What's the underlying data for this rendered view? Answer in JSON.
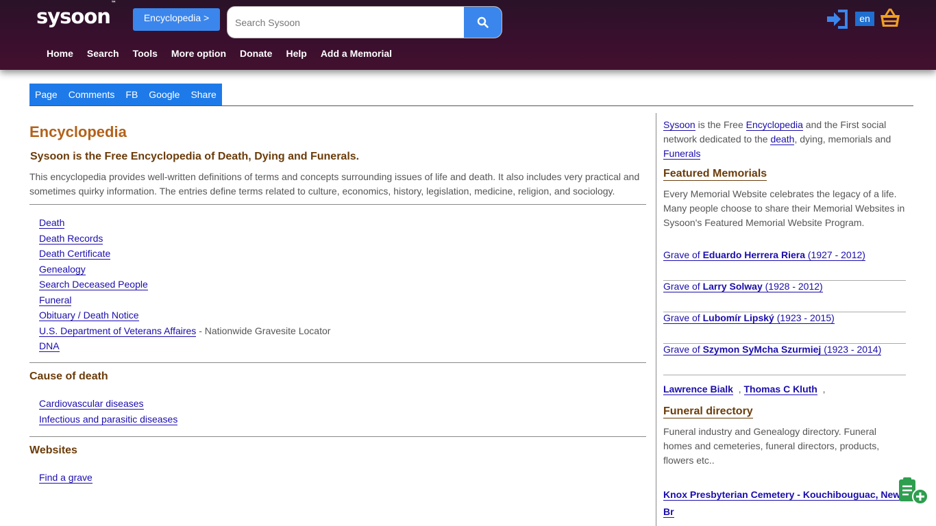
{
  "header": {
    "logo": "sysoon",
    "logo_tm": "™",
    "section_button": "Encyclopedia >",
    "search_placeholder": "Search Sysoon",
    "language": "en",
    "nav": [
      "Home",
      "Search",
      "Tools",
      "More option",
      "Donate",
      "Help",
      "Add a Memorial"
    ]
  },
  "tabs": [
    "Page",
    "Comments",
    "FB",
    "Google",
    "Share"
  ],
  "main": {
    "title": "Encyclopedia",
    "subtitle": "Sysoon is the Free Encyclopedia of Death, Dying and Funerals.",
    "intro": "This encyclopedia provides well-written definitions of terms and concepts surrounding issues of life and death. It also includes very practical and sometimes quirky information. The entries define terms related to culture, economics, history, legislation, medicine, religion, and sociology.",
    "links": [
      {
        "label": "Death",
        "suffix": ""
      },
      {
        "label": "Death Records",
        "suffix": ""
      },
      {
        "label": "Death Certificate",
        "suffix": ""
      },
      {
        "label": "Genealogy",
        "suffix": ""
      },
      {
        "label": "Search Deceased People",
        "suffix": ""
      },
      {
        "label": "Funeral",
        "suffix": ""
      },
      {
        "label": "Obituary / Death Notice",
        "suffix": ""
      },
      {
        "label": "U.S. Department of Veterans Affaires",
        "suffix": " - Nationwide Gravesite Locator"
      },
      {
        "label": "DNA",
        "suffix": ""
      }
    ],
    "cause_title": "Cause of death",
    "cause_links": [
      "Cardiovascular diseases",
      "Infectious and parasitic diseases"
    ],
    "websites_title": "Websites",
    "website_links": [
      "Find a grave"
    ]
  },
  "sidebar": {
    "intro_parts": {
      "sysoon": "Sysoon",
      "t1": " is the Free ",
      "encyclopedia": "Encyclopedia",
      "t2": " and the First social network dedicated to the ",
      "death": "death",
      "t3": ", dying, memorials and ",
      "funerals": "Funerals"
    },
    "featured_title": "Featured Memorials",
    "featured_text": "Every Memorial Website celebrates the legacy of a life. Many people choose to share their Memorial Websites in Sysoon's Featured Memorial Website Program.",
    "graves": [
      {
        "prefix": "Grave of ",
        "name": "Eduardo Herrera Riera",
        "years": " (1927 - 2012)"
      },
      {
        "prefix": "Grave of ",
        "name": "Larry Solway",
        "years": " (1928 - 2012)"
      },
      {
        "prefix": "Grave of ",
        "name": "Lubomír Lipský",
        "years": " (1923 - 2015)"
      },
      {
        "prefix": "Grave of ",
        "name": "Szymon SyMcha Szurmiej",
        "years": " (1923 - 2014)"
      }
    ],
    "people": [
      "Lawrence Bialk",
      "Thomas C Kluth"
    ],
    "funeral_title": "Funeral directory",
    "funeral_text": "Funeral industry and Genealogy directory. Funeral homes and cemeteries, funeral directors, products, flowers etc..",
    "knox": "Knox Presbyterian Cemetery - Kouchibouguac, New Br"
  },
  "colors": {
    "accent": "#3b86ec",
    "header_bg": "#3a0f2e",
    "heading": "#6b3c0a",
    "title": "#b3621a",
    "link": "#1a0dab"
  }
}
